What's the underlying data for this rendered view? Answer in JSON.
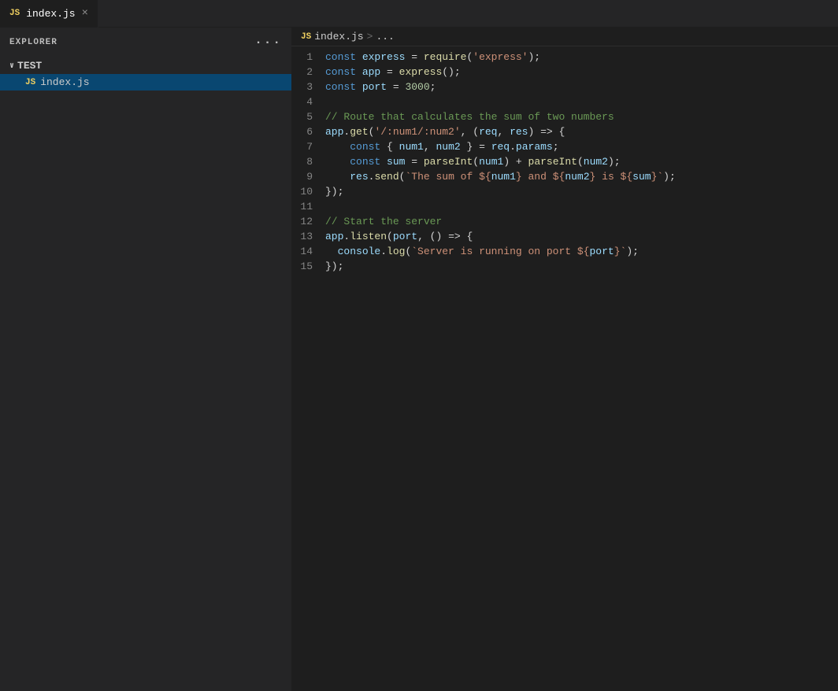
{
  "sidebar": {
    "header": "EXPLORER",
    "dots": "···",
    "folder": {
      "label": "TEST",
      "chevron": "∨"
    },
    "file": {
      "badge": "JS",
      "name": "index.js"
    }
  },
  "tab": {
    "badge": "JS",
    "filename": "index.js",
    "close": "×"
  },
  "breadcrumb": {
    "badge": "JS",
    "filename": "index.js",
    "sep": ">",
    "rest": "..."
  },
  "editor": {
    "title": "index.js"
  }
}
